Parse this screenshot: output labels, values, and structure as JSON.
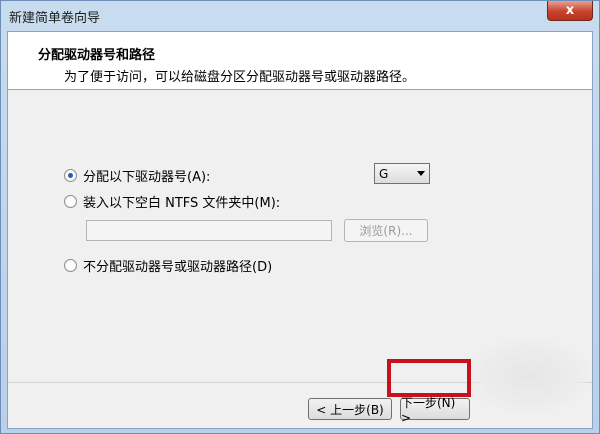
{
  "window": {
    "title": "新建简单卷向导",
    "close_label": "x"
  },
  "header": {
    "title": "分配驱动器号和路径",
    "subtitle": "为了便于访问，可以给磁盘分区分配驱动器号或驱动器路径。"
  },
  "options": {
    "assign_letter": {
      "label": "分配以下驱动器号(A):",
      "checked": true
    },
    "mount_folder": {
      "label": "装入以下空白 NTFS 文件夹中(M):",
      "checked": false
    },
    "no_assign": {
      "label": "不分配驱动器号或驱动器路径(D)",
      "checked": false
    }
  },
  "drive_letter": {
    "selected": "G"
  },
  "folder_path": {
    "value": ""
  },
  "buttons": {
    "browse": "浏览(R)...",
    "back": "< 上一步(B)",
    "next": "下一步(N) >"
  }
}
